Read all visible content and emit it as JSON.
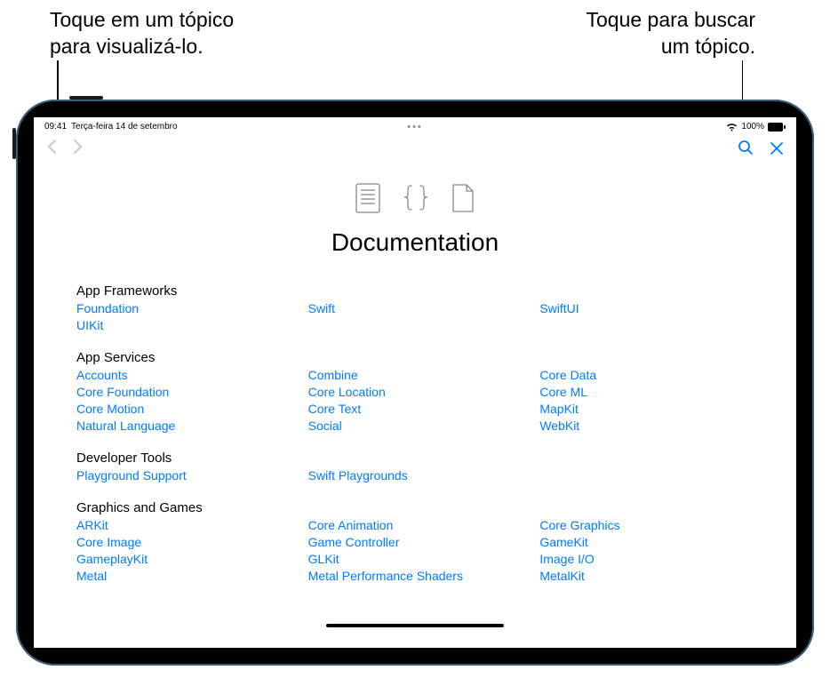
{
  "callouts": {
    "left_line1": "Toque em um tópico",
    "left_line2": "para visualizá-lo.",
    "right_line1": "Toque para buscar",
    "right_line2": "um tópico."
  },
  "status": {
    "time": "09:41",
    "date": "Terça-feira 14 de setembro",
    "battery": "100%"
  },
  "doc": {
    "title": "Documentation"
  },
  "sections": [
    {
      "header": "App Frameworks",
      "links": [
        "Foundation",
        "Swift",
        "SwiftUI",
        "UIKit"
      ]
    },
    {
      "header": "App Services",
      "links": [
        "Accounts",
        "Combine",
        "Core Data",
        "Core Foundation",
        "Core Location",
        "Core ML",
        "Core Motion",
        "Core Text",
        "MapKit",
        "Natural Language",
        "Social",
        "WebKit"
      ]
    },
    {
      "header": "Developer Tools",
      "links": [
        "Playground Support",
        "Swift Playgrounds"
      ]
    },
    {
      "header": "Graphics and Games",
      "links": [
        "ARKit",
        "Core Animation",
        "Core Graphics",
        "Core Image",
        "Game Controller",
        "GameKit",
        "GameplayKit",
        "GLKit",
        "Image I/O",
        "Metal",
        "Metal Performance Shaders",
        "MetalKit"
      ]
    }
  ]
}
